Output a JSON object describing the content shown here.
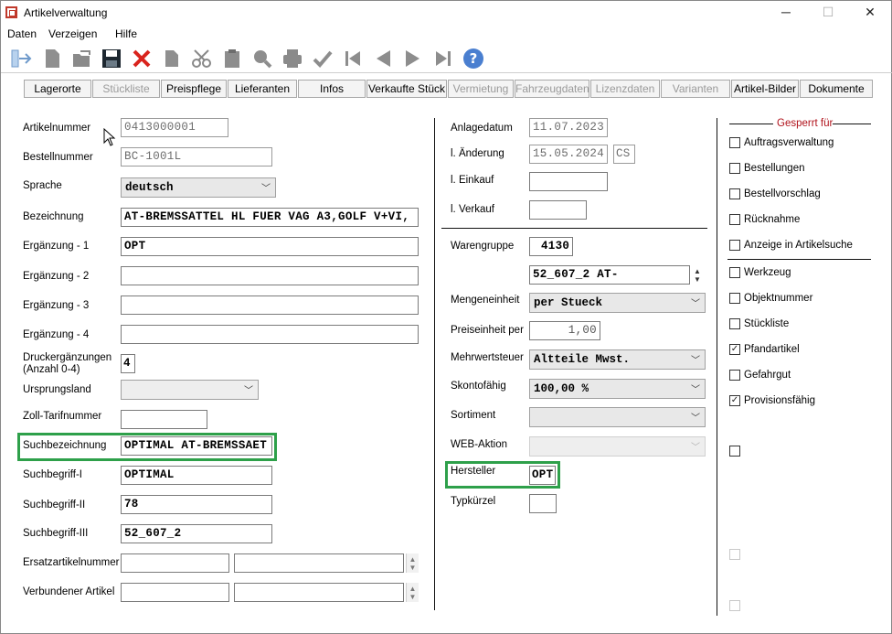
{
  "window": {
    "title": "Artikelverwaltung",
    "minimize": "─",
    "maximize": "☐",
    "close": "✕"
  },
  "menu": [
    "Daten",
    "Verzeigen",
    "Hilfe"
  ],
  "tabs": [
    {
      "label": "Lagerorte",
      "enabled": true
    },
    {
      "label": "Stückliste",
      "enabled": false
    },
    {
      "label": "Preispflege",
      "enabled": true
    },
    {
      "label": "Lieferanten",
      "enabled": true
    },
    {
      "label": "Infos",
      "enabled": true
    },
    {
      "label": "Verkaufte Stück",
      "enabled": true
    },
    {
      "label": "Vermietung",
      "enabled": false
    },
    {
      "label": "Fahrzeugdaten",
      "enabled": false
    },
    {
      "label": "Lizenzdaten",
      "enabled": false
    },
    {
      "label": "Varianten",
      "enabled": false
    },
    {
      "label": "Artikel-Bilder",
      "enabled": true
    },
    {
      "label": "Dokumente",
      "enabled": true
    }
  ],
  "left": {
    "artikelnummer": {
      "label": "Artikelnummer",
      "value": "0413000001"
    },
    "bestellnummer": {
      "label": "Bestellnummer",
      "value": "BC-1001L"
    },
    "sprache": {
      "label": "Sprache",
      "value": "deutsch"
    },
    "bezeichnung": {
      "label": "Bezeichnung",
      "value": "AT-BREMSSATTEL HL FUER VAG A3,GOLF V+VI,"
    },
    "ergaenzung1": {
      "label": "Ergänzung - 1",
      "value": "OPT"
    },
    "ergaenzung2": {
      "label": "Ergänzung - 2",
      "value": ""
    },
    "ergaenzung3": {
      "label": "Ergänzung - 3",
      "value": ""
    },
    "ergaenzung4": {
      "label": "Ergänzung - 4",
      "value": ""
    },
    "druck": {
      "label1": "Druckergänzungen",
      "label2": "(Anzahl 0-4)",
      "value": "4"
    },
    "ursprungsland": {
      "label": "Ursprungsland",
      "value": ""
    },
    "zolltarif": {
      "label": "Zoll-Tarifnummer",
      "value": ""
    },
    "suchbezeichnung": {
      "label": "Suchbezeichnung",
      "value": "OPTIMAL AT-BREMSSAET"
    },
    "suchbegriff1": {
      "label": "Suchbegriff-I",
      "value": "OPTIMAL"
    },
    "suchbegriff2": {
      "label": "Suchbegriff-II",
      "value": "78"
    },
    "suchbegriff3": {
      "label": "Suchbegriff-III",
      "value": "52_607_2"
    },
    "ersatzartikel": {
      "label": "Ersatzartikelnummer",
      "value": ""
    },
    "verbunden": {
      "label": "Verbundener Artikel",
      "value": ""
    }
  },
  "mid": {
    "anlagedatum": {
      "label": "Anlagedatum",
      "value": "11.07.2023"
    },
    "aenderung": {
      "label": "l. Änderung",
      "value": "15.05.2024",
      "user": "CS"
    },
    "einkauf": {
      "label": "l. Einkauf",
      "value": ""
    },
    "verkauf": {
      "label": "l. Verkauf",
      "value": ""
    },
    "warengruppe": {
      "label": "Warengruppe",
      "value": "4130",
      "sub": "52_607_2 AT-"
    },
    "mengeneinheit": {
      "label": "Mengeneinheit",
      "value": "per Stueck"
    },
    "preiseinheit": {
      "label": "Preiseinheit per",
      "value": "1,00"
    },
    "mwst": {
      "label": "Mehrwertsteuer",
      "value": "Altteile Mwst."
    },
    "skonto": {
      "label": "Skontofähig",
      "value": "100,00 %"
    },
    "sortiment": {
      "label": "Sortiment",
      "value": ""
    },
    "web": {
      "label": "WEB-Aktion",
      "value": ""
    },
    "hersteller": {
      "label": "Hersteller",
      "value": "OPT"
    },
    "typ": {
      "label": "Typkürzel",
      "value": ""
    }
  },
  "right": {
    "gesperrt": "Gesperrt für",
    "flags": [
      {
        "label": "Auftragsverwaltung",
        "checked": false
      },
      {
        "label": "Bestellungen",
        "checked": false
      },
      {
        "label": "Bestellvorschlag",
        "checked": false
      },
      {
        "label": "Rücknahme",
        "checked": false
      },
      {
        "label": "Anzeige in Artikelsuche",
        "checked": false
      },
      {
        "label": "Werkzeug",
        "checked": false
      },
      {
        "label": "Objektnummer",
        "checked": false
      },
      {
        "label": "Stückliste",
        "checked": false
      },
      {
        "label": "Pfandartikel",
        "checked": true
      },
      {
        "label": "Gefahrgut",
        "checked": false
      },
      {
        "label": "Provisionsfähig",
        "checked": true
      }
    ]
  },
  "colors": {
    "highlight": "#2ea04a",
    "gesperrt": "#b0121b",
    "help": "#4a7fd0"
  },
  "icons": [
    "exit-icon",
    "new-icon",
    "open-icon",
    "save-icon",
    "delete-icon",
    "copy-icon",
    "cut-icon",
    "paste-icon",
    "search-icon",
    "print-icon",
    "confirm-icon",
    "first-icon",
    "prev-icon",
    "next-icon",
    "last-icon",
    "help-icon"
  ]
}
